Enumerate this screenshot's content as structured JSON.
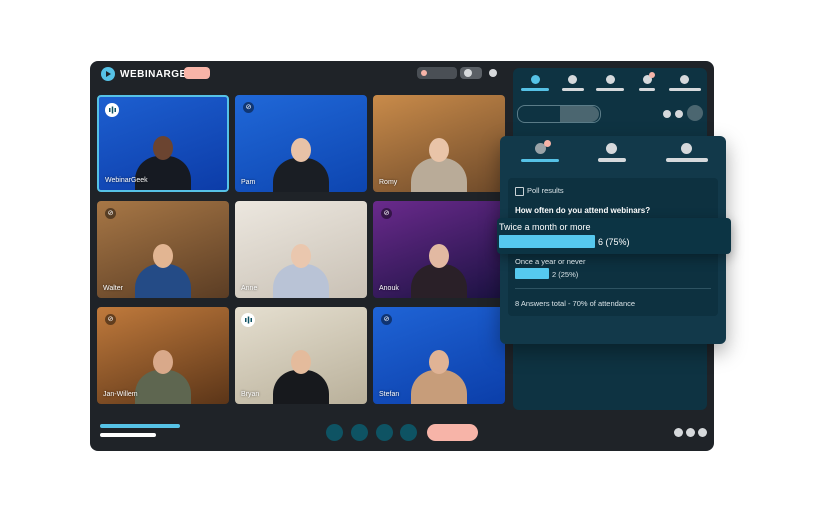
{
  "brand": {
    "name": "WEBINARGEEK",
    "accent": "#56c2e6",
    "record_color": "#f7b4a8"
  },
  "participants": [
    {
      "name": "WebinarGeek",
      "state": "speaking"
    },
    {
      "name": "Pam",
      "state": "muted"
    },
    {
      "name": "Romy",
      "state": ""
    },
    {
      "name": "Walter",
      "state": "muted"
    },
    {
      "name": "Anne",
      "state": ""
    },
    {
      "name": "Anouk",
      "state": "muted"
    },
    {
      "name": "Jan-Willem",
      "state": "muted"
    },
    {
      "name": "Bryan",
      "state": "speaking"
    },
    {
      "name": "Stefan",
      "state": "muted"
    }
  ],
  "poll": {
    "header": "Poll results",
    "question": "How often do you attend webinars?",
    "options": [
      {
        "label": "Twice a month or more",
        "result": "6 (75%)",
        "fraction": 0.75
      },
      {
        "label": "Once a year or never",
        "result": "2 (25%)",
        "fraction": 0.25
      }
    ],
    "footer": "8 Answers total - 70% of attendance"
  }
}
